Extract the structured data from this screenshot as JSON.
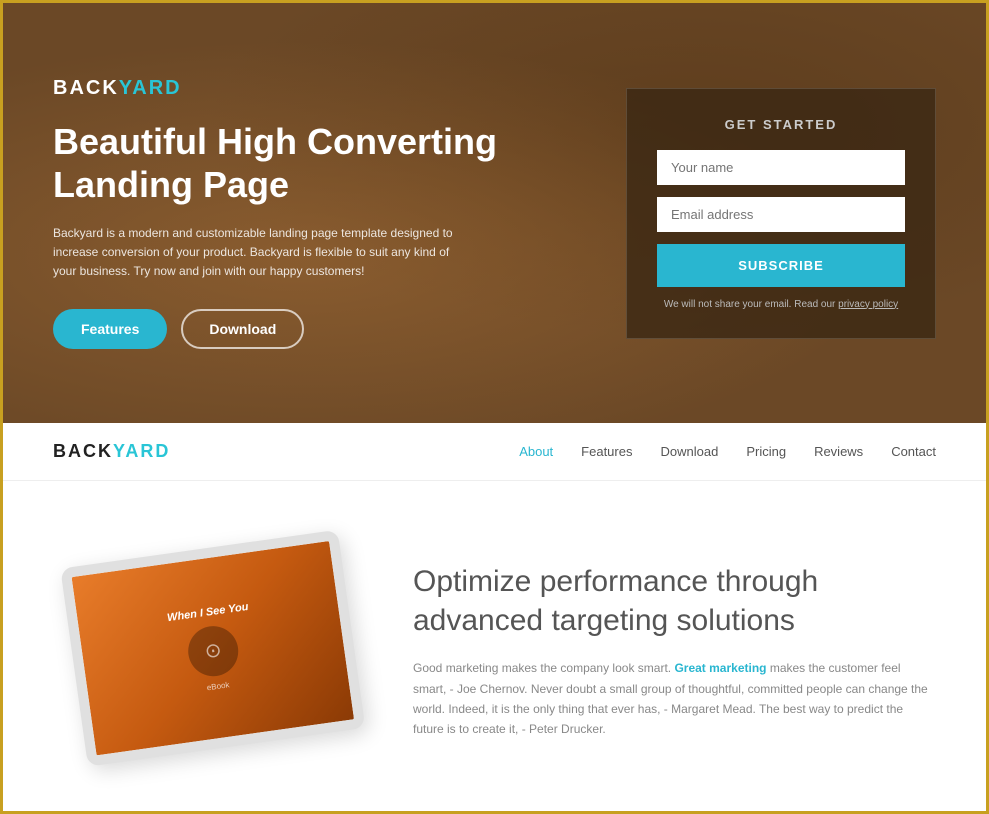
{
  "hero": {
    "logo": {
      "back": "BACK",
      "yard": "YARD"
    },
    "headline": "Beautiful High Converting Landing Page",
    "subtext": "Backyard is a modern and customizable landing page template designed to increase conversion of your product. Backyard is flexible to suit any kind of your business. Try now and join with our happy customers!",
    "btn_features": "Features",
    "btn_download": "Download"
  },
  "form": {
    "title": "GET STARTED",
    "name_placeholder": "Your name",
    "email_placeholder": "Email address",
    "subscribe_label": "SUBSCRIBE",
    "privacy_text": "We will not share your email. Read our ",
    "privacy_link": "privacy policy"
  },
  "navbar": {
    "logo": {
      "back": "BACK",
      "yard": "YARD"
    },
    "nav_items": [
      {
        "label": "About",
        "active": true
      },
      {
        "label": "Features",
        "active": false
      },
      {
        "label": "Download",
        "active": false
      },
      {
        "label": "Pricing",
        "active": false
      },
      {
        "label": "Reviews",
        "active": false
      },
      {
        "label": "Contact",
        "active": false
      }
    ]
  },
  "content": {
    "tablet_title": "When I See You",
    "headline": "Optimize performance through advanced targeting solutions",
    "body_start": "Good marketing makes the company look smart. ",
    "body_highlight": "Great marketing",
    "body_end": " makes the customer feel smart, - Joe Chernov. Never doubt a small group of thoughtful, committed people can change the world. Indeed, it is the only thing that ever has, - Margaret Mead. The best way to predict the future is to create it, - Peter Drucker."
  }
}
